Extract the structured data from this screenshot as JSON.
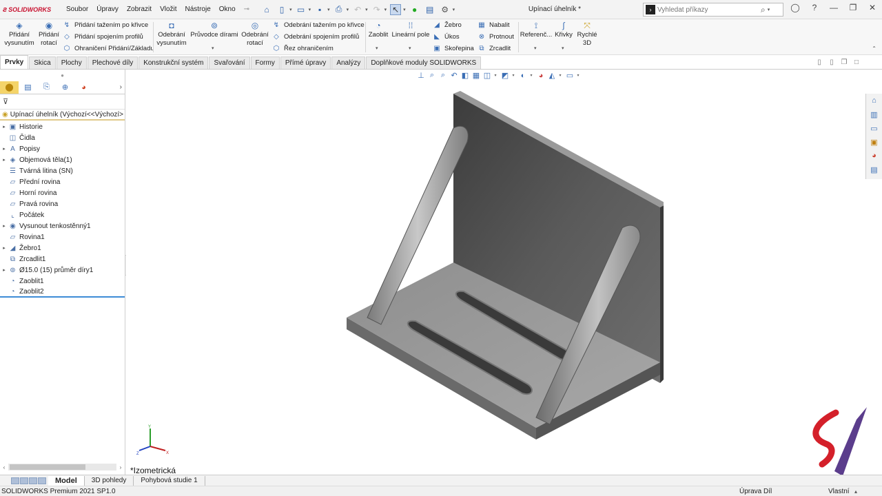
{
  "app": {
    "logo": "SOLIDWORKS",
    "document_title": "Upínací úhelník *"
  },
  "menu": [
    "Soubor",
    "Úpravy",
    "Zobrazit",
    "Vložit",
    "Nástroje",
    "Okno"
  ],
  "search": {
    "placeholder": "Vyhledat příkazy"
  },
  "ribbon": {
    "extrude": [
      "Přidání",
      "vysunutím"
    ],
    "revolve": [
      "Přidání",
      "rotací"
    ],
    "sweep": "Přidání tažením po křivce",
    "loft": "Přidání spojením profilů",
    "boundary": "Ohraničení Přidání/Základu",
    "cut_extrude": [
      "Odebrání",
      "vysunutím"
    ],
    "hole_wizard": "Průvodce dírami",
    "cut_revolve": [
      "Odebrání",
      "rotací"
    ],
    "cut_sweep": "Odebrání tažením po křivce",
    "cut_loft": "Odebrání spojením profilů",
    "boundary_cut": "Řez ohraničením",
    "fillet": "Zaoblit",
    "linear_pattern": "Lineární pole",
    "rib": "Žebro",
    "draft": "Úkos",
    "shell": "Skořepina",
    "wrap": "Nabalit",
    "intersect": "Protnout",
    "mirror": "Zrcadlit",
    "reference": "Referenč...",
    "curves": "Křivky",
    "instant3d": [
      "Rychlé",
      "3D"
    ]
  },
  "tabs": [
    "Prvky",
    "Skica",
    "Plochy",
    "Plechové díly",
    "Konstrukční systém",
    "Svařování",
    "Formy",
    "Přímé úpravy",
    "Analýzy",
    "Doplňkové moduly SOLIDWORKS"
  ],
  "tree": {
    "root": "Upínací úhelník  (Výchozí<<Výchozí>",
    "items": [
      {
        "label": "Historie",
        "icon": "folder-icon",
        "expand": true
      },
      {
        "label": "Čidla",
        "icon": "sensor-icon",
        "expand": false
      },
      {
        "label": "Popisy",
        "icon": "annotation-icon",
        "expand": true
      },
      {
        "label": "Objemová těla(1)",
        "icon": "solid-body-icon",
        "expand": true
      },
      {
        "label": "Tvárná litina (SN)",
        "icon": "material-icon",
        "expand": false
      },
      {
        "label": "Přední rovina",
        "icon": "plane-icon",
        "expand": false
      },
      {
        "label": "Horní rovina",
        "icon": "plane-icon",
        "expand": false
      },
      {
        "label": "Pravá rovina",
        "icon": "plane-icon",
        "expand": false
      },
      {
        "label": "Počátek",
        "icon": "origin-icon",
        "expand": false
      },
      {
        "label": "Vysunout tenkostěnný1",
        "icon": "extrude-icon",
        "expand": true
      },
      {
        "label": "Rovina1",
        "icon": "plane-icon",
        "expand": false
      },
      {
        "label": "Žebro1",
        "icon": "rib-icon",
        "expand": true
      },
      {
        "label": "Zrcadlit1",
        "icon": "mirror-icon",
        "expand": false
      },
      {
        "label": "Ø15.0 (15) průměr díry1",
        "icon": "hole-icon",
        "expand": true
      },
      {
        "label": "Zaoblit1",
        "icon": "fillet-icon",
        "expand": false
      },
      {
        "label": "Zaoblit2",
        "icon": "fillet-icon",
        "expand": false
      }
    ]
  },
  "viewport": {
    "view_name": "*Izometrická",
    "triad": {
      "x": "X",
      "y": "Y",
      "z": "Z"
    }
  },
  "bottom_tabs": [
    "Model",
    "3D pohledy",
    "Pohybová studie 1"
  ],
  "status": {
    "left": "SOLIDWORKS Premium 2021 SP1.0",
    "mode": "Úprava Díl",
    "units": "Vlastní"
  }
}
